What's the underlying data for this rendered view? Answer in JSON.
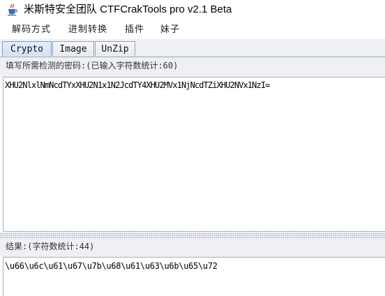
{
  "window": {
    "title": "米斯特安全团队 CTFCrakTools pro v2.1 Beta",
    "icon": "java-cup-icon"
  },
  "menubar": {
    "items": [
      {
        "label": "解码方式"
      },
      {
        "label": "进制转换"
      },
      {
        "label": "插件"
      },
      {
        "label": "妹子"
      }
    ]
  },
  "tabs": [
    {
      "label": "Crypto",
      "active": true
    },
    {
      "label": "Image",
      "active": false
    },
    {
      "label": "UnZip",
      "active": false
    }
  ],
  "input_panel": {
    "label": "填写所需检测的密码:(已输入字符数统计:60)",
    "value": "XHU2NlxlNmNcdTYxXHU2N1x1N2JcdTY4XHU2MVx1NjNcdTZiXHU2NVx1NzI="
  },
  "result_panel": {
    "label": "结果:(字符数统计:44)",
    "value": "\\u66\\u6c\\u61\\u67\\u7b\\u68\\u61\\u63\\u6b\\u65\\u72"
  },
  "colors": {
    "active_tab": "#cfe1f5",
    "panel_bg": "#eef0f4",
    "border": "#a7b0bb"
  }
}
